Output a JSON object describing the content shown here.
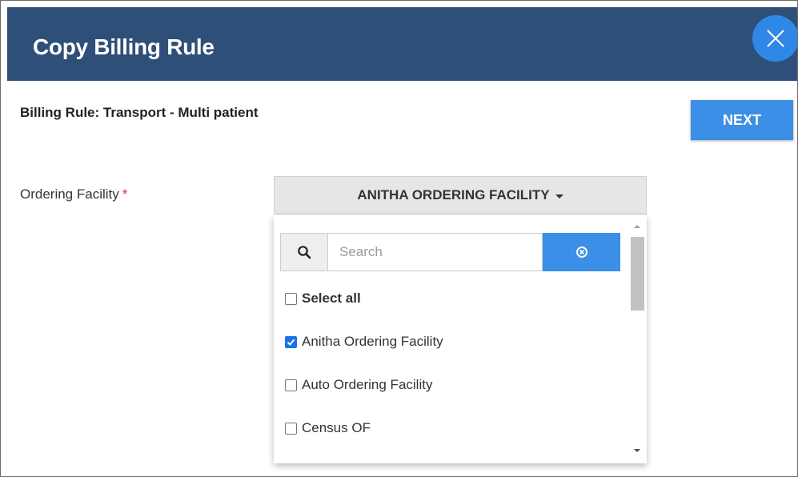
{
  "dialog": {
    "title": "Copy Billing Rule",
    "rule_label": "Billing Rule: Transport - Multi patient",
    "next_label": "NEXT"
  },
  "facility": {
    "label": "Ordering Facility",
    "required_mark": "*",
    "selected_value": "ANITHA ORDERING FACILITY"
  },
  "dropdown": {
    "search_placeholder": "Search",
    "search_value": "",
    "select_all_label": "Select all",
    "select_all_checked": false,
    "options": [
      {
        "label": "Anitha Ordering Facility",
        "checked": true
      },
      {
        "label": "Auto Ordering Facility",
        "checked": false
      },
      {
        "label": "Census OF",
        "checked": false
      }
    ]
  },
  "colors": {
    "header_bg": "#2e5078",
    "accent": "#3b8fe6",
    "required": "#d32f2f"
  },
  "icons": {
    "close": "close-icon",
    "search": "search-icon",
    "clear": "clear-circle-icon",
    "caret": "caret-down-icon",
    "check": "check-icon"
  }
}
